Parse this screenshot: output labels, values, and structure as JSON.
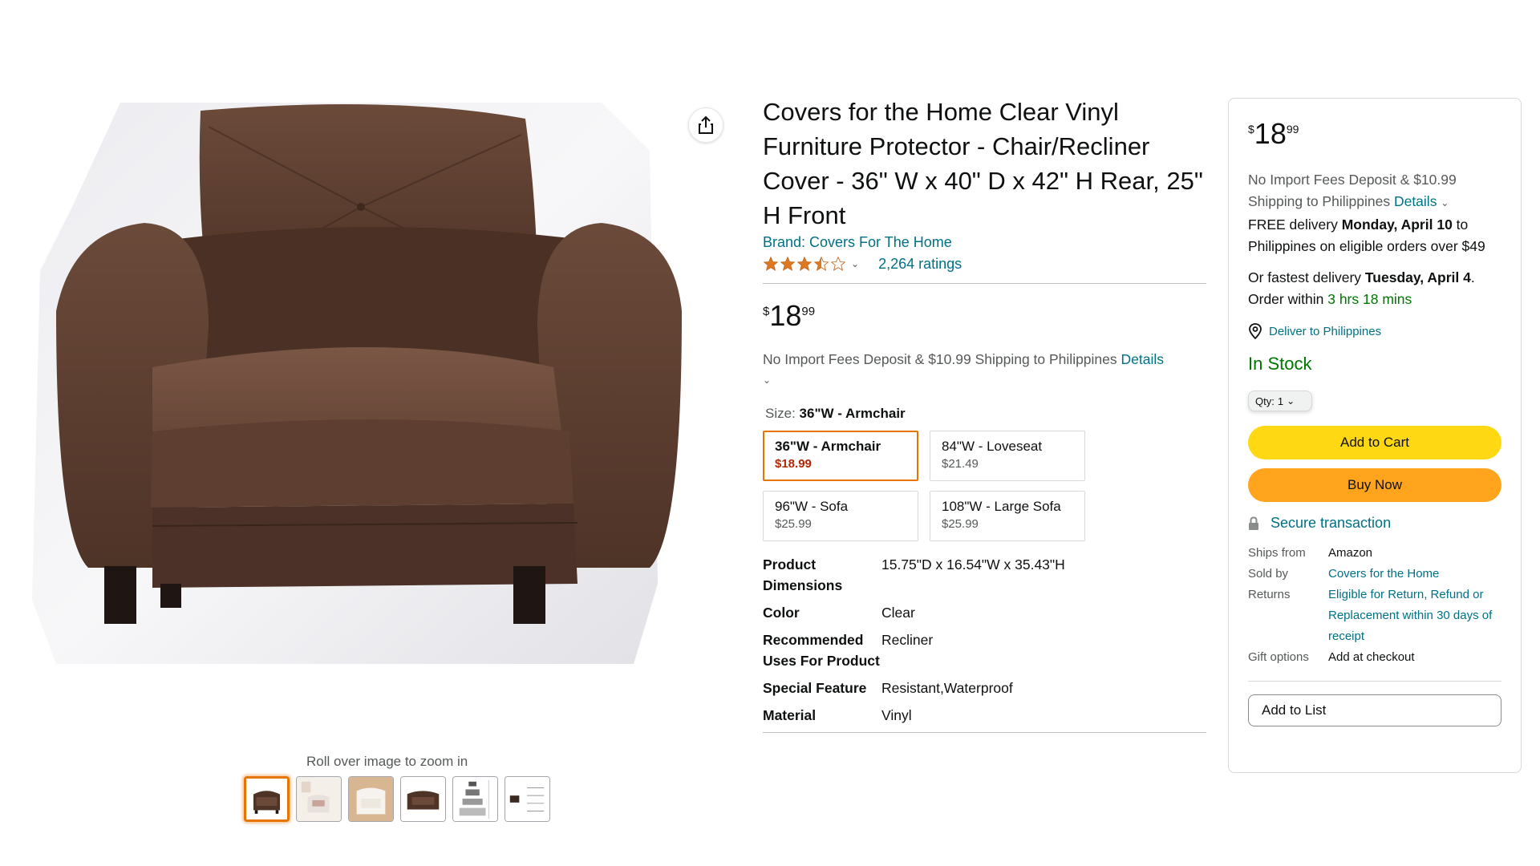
{
  "gallery": {
    "zoom_hint": "Roll over image to zoom in",
    "thumbnails": [
      {
        "name": "armchair-front"
      },
      {
        "name": "cover-room"
      },
      {
        "name": "cover-chair-white"
      },
      {
        "name": "armchair-angle"
      },
      {
        "name": "size-chart"
      },
      {
        "name": "dimensions-diagram"
      }
    ]
  },
  "product": {
    "title": "Covers for the Home Clear Vinyl Furniture Protector - Chair/Recliner Cover - 36\" W x 40\" D x 42\" H Rear, 25\" H Front",
    "brand": "Brand: Covers For The Home",
    "rating": 3.5,
    "ratings_count": "2,264 ratings",
    "price": {
      "symbol": "$",
      "whole": "18",
      "fraction": "99"
    },
    "import_note": "No Import Fees Deposit & $10.99 Shipping to Philippines",
    "import_details": "Details",
    "size_label": "Size:",
    "size_value": "36\"W - Armchair",
    "variants": [
      {
        "name": "36\"W - Armchair",
        "price": "$18.99",
        "selected": true
      },
      {
        "name": "84\"W - Loveseat",
        "price": "$21.49",
        "selected": false
      },
      {
        "name": "96\"W - Sofa",
        "price": "$25.99",
        "selected": false
      },
      {
        "name": "108\"W - Large Sofa",
        "price": "$25.99",
        "selected": false
      }
    ],
    "specs": [
      {
        "key": "Product Dimensions",
        "value": "15.75\"D x 16.54\"W x 35.43\"H"
      },
      {
        "key": "Color",
        "value": "Clear"
      },
      {
        "key": "Recommended Uses For Product",
        "value": "Recliner"
      },
      {
        "key": "Special Feature",
        "value": "Resistant,Waterproof"
      },
      {
        "key": "Material",
        "value": "Vinyl"
      }
    ]
  },
  "buybox": {
    "price": {
      "symbol": "$",
      "whole": "18",
      "fraction": "99"
    },
    "import_note": "No Import Fees Deposit & $10.99 Shipping to Philippines",
    "import_details": "Details",
    "free_delivery_prefix": "FREE delivery",
    "free_delivery_date": "Monday, April 10",
    "free_delivery_suffix": "to Philippines on eligible orders over $49",
    "fastest_prefix": "Or fastest delivery",
    "fastest_date": "Tuesday, April 4",
    "order_within_prefix": "Order within",
    "order_within_time": "3 hrs 18 mins",
    "deliver_to": "Deliver to Philippines",
    "stock": "In Stock",
    "qty_label": "Qty:",
    "qty_value": "1",
    "add_to_cart": "Add to Cart",
    "buy_now": "Buy Now",
    "secure": "Secure transaction",
    "ships_from_label": "Ships from",
    "ships_from": "Amazon",
    "sold_by_label": "Sold by",
    "sold_by": "Covers for the Home",
    "returns_label": "Returns",
    "returns": "Eligible for Return, Refund or Replacement within 30 days of receipt",
    "gift_label": "Gift options",
    "gift": "Add at checkout",
    "add_to_list": "Add to List"
  },
  "colors": {
    "link": "#007185",
    "price_red": "#b12704",
    "in_stock_green": "#007600",
    "cart_yellow": "#ffd814",
    "buy_orange": "#ffa41c",
    "selected_border": "#e77600",
    "star": "#de7921"
  }
}
